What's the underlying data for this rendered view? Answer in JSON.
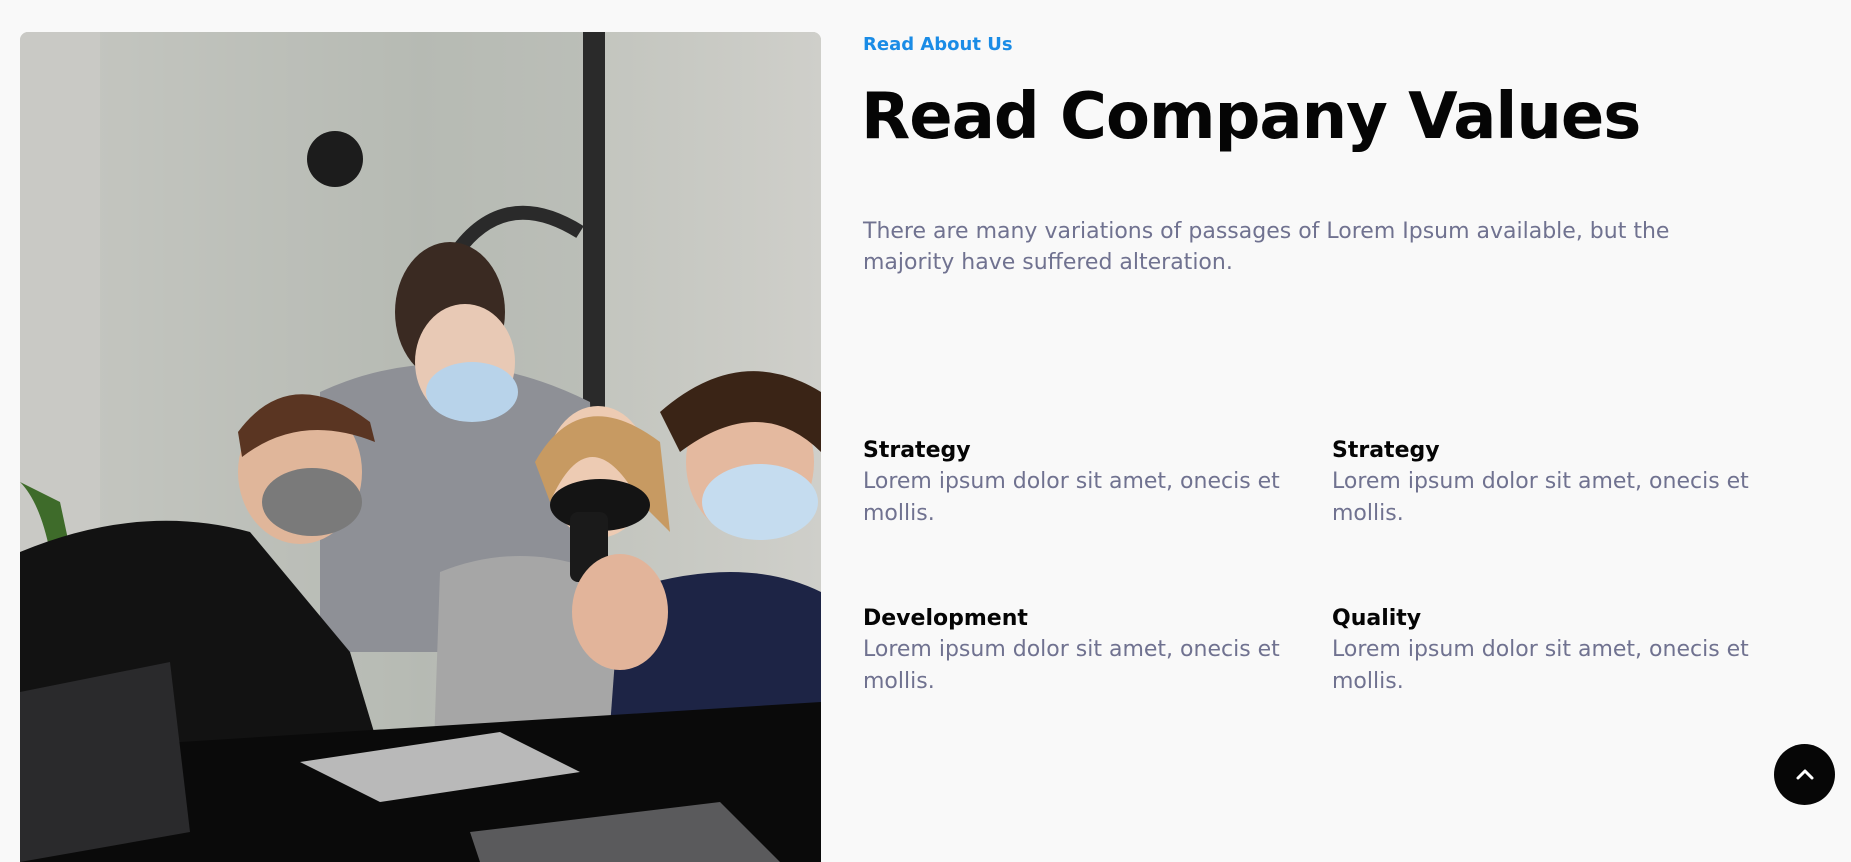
{
  "hero_image": {
    "description_icon": "team-photo"
  },
  "section": {
    "eyebrow": "Read About Us",
    "title": "Read Company Values",
    "lead": "There are many variations of passages of Lorem Ipsum available, but the majority have suffered alteration."
  },
  "features": [
    {
      "title": "Strategy",
      "text": "Lorem ipsum dolor sit amet, onecis et mollis."
    },
    {
      "title": "Strategy",
      "text": "Lorem ipsum dolor sit amet, onecis et mollis."
    },
    {
      "title": "Development",
      "text": "Lorem ipsum dolor sit amet, onecis et mollis."
    },
    {
      "title": "Quality",
      "text": "Lorem ipsum dolor sit amet, onecis et mollis."
    }
  ],
  "scroll_top": {
    "icon": "chevron-up-icon"
  },
  "colors": {
    "accent": "#1a8ce6",
    "muted_text": "#707290",
    "heading": "#050505",
    "background": "#f9f9f9"
  }
}
